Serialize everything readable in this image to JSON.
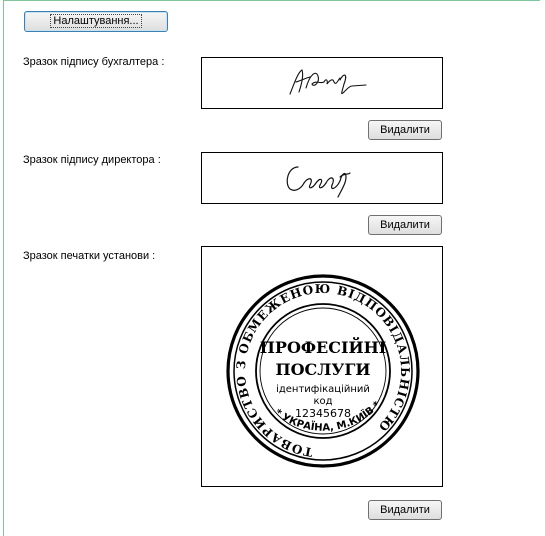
{
  "toolbar": {
    "settings_label": "Налаштування..."
  },
  "signatures": {
    "accountant": {
      "label": "Зразок підпису бухгалтера :",
      "delete_label": "Видалити"
    },
    "director": {
      "label": "Зразок підпису директора :",
      "delete_label": "Видалити"
    }
  },
  "stamp": {
    "label": "Зразок печатки установи :",
    "delete_label": "Видалити",
    "ring_text": "ТОВАРИСТВО З ОБМЕЖЕНОЮ ВІДПОВІДАЛЬНІСТЮ",
    "bottom_text": "* УКРАЇНА, М.КИЇВ *",
    "center_line1": "ПРОФЕСІЙНІ",
    "center_line2": "ПОСЛУГИ",
    "id_label_1": "ідентифікаційний",
    "id_label_2": "код",
    "id_code": "12345678"
  },
  "colors": {
    "border_accent": "#7fc79a",
    "ink": "#000000"
  }
}
